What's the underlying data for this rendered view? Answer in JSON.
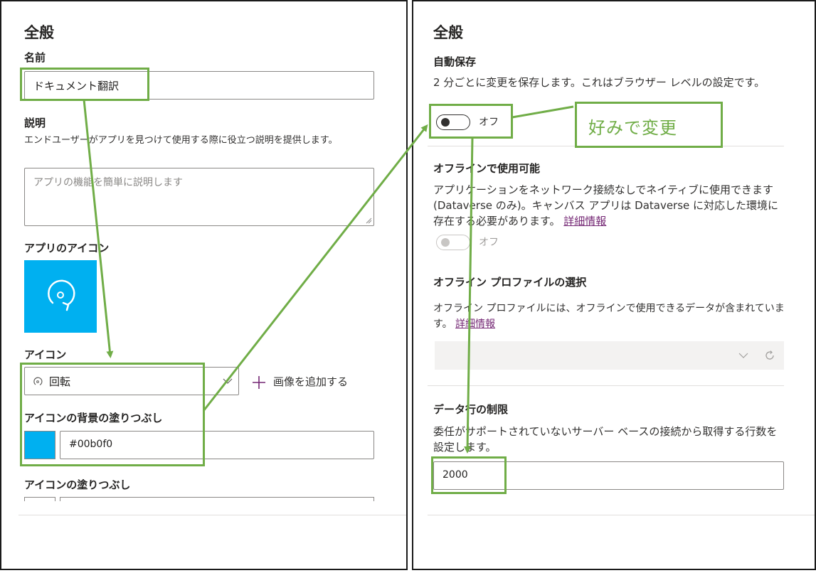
{
  "left": {
    "section_title": "全般",
    "name_label": "名前",
    "name_value": "ドキュメント翻訳",
    "description_label": "説明",
    "description_help": "エンドユーザーがアプリを見つけて使用する際に役立つ説明を提供します。",
    "description_placeholder": "アプリの機能を簡単に説明します",
    "app_icon_label": "アプリのアイコン",
    "icon_label": "アイコン",
    "icon_selected": "回転",
    "add_image_label": "画像を追加する",
    "icon_bg_fill_label": "アイコンの背景の塗りつぶし",
    "icon_bg_color": "#00b0f0",
    "icon_fill_label": "アイコンの塗りつぶし"
  },
  "right": {
    "section_title": "全般",
    "autosave_label": "自動保存",
    "autosave_desc": "2 分ごとに変更を保存します。これはブラウザー レベルの設定です。",
    "autosave_state": "オフ",
    "offline_label": "オフラインで使用可能",
    "offline_desc": "アプリケーションをネットワーク接続なしでネイティブに使用できます (Dataverse のみ)。キャンバス アプリは Dataverse に対応した環境に存在する必要があります。",
    "offline_link": "詳細情報",
    "offline_state": "オフ",
    "offline_profile_label": "オフライン プロファイルの選択",
    "offline_profile_desc": "オフライン プロファイルには、オフラインで使用できるデータが含まれています。",
    "offline_profile_link": "詳細情報",
    "row_limit_label": "データ行の制限",
    "row_limit_desc": "委任がサポートされていないサーバー ベースの接続から取得する行数を設定します。",
    "row_limit_value": "2000"
  },
  "annotation": {
    "callout": "好みで変更",
    "color": "#70ad47"
  },
  "colors": {
    "icon_tile": "#00b0f0",
    "link": "#742774",
    "border": "#8a8886"
  }
}
